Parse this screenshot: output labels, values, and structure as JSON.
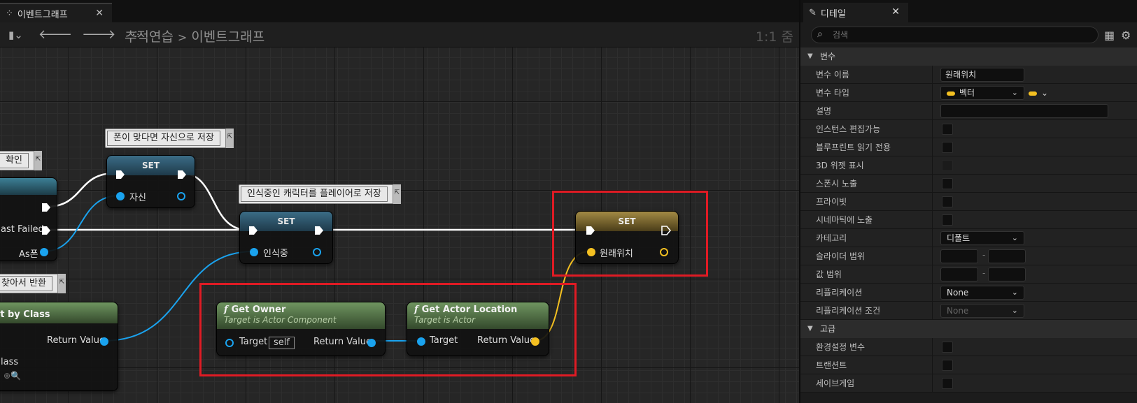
{
  "graph": {
    "tab_title": "이벤트그래프",
    "tab_icon": "graph-tab-icon",
    "breadcrumb": {
      "parent": "추적연습",
      "separator": ">",
      "current": "이벤트그래프"
    },
    "zoom_label": "1:1 줌"
  },
  "nodes": {
    "set1": {
      "title": "SET",
      "var_label": "자신"
    },
    "set2": {
      "title": "SET",
      "var_label": "인식중"
    },
    "set3": {
      "title": "SET",
      "var_label": "원래위치"
    },
    "cast_partial": {
      "failed_label": "ast Failed",
      "as_label": "As폰"
    },
    "getbyclass_partial": {
      "title": "nt by Class",
      "return_label": "Return Value",
      "class_label": "lass"
    },
    "get_owner": {
      "title": "Get Owner",
      "subtitle": "Target is Actor Component",
      "target_label": "Target",
      "self_value": "self",
      "return_label": "Return Value"
    },
    "get_actor_location": {
      "title": "Get Actor Location",
      "subtitle": "Target is Actor",
      "target_label": "Target",
      "return_label": "Return Value"
    }
  },
  "comments": {
    "c1": "폰이 맞다면 자신으로 저장",
    "c2": "인식중인 캐릭터를 플레이어로 저장",
    "c3": "확인",
    "c4": "찾아서 반환"
  },
  "details": {
    "tab_title": "디테일",
    "search_placeholder": "검색",
    "sections": {
      "variable": "변수",
      "advanced": "고급"
    },
    "props": {
      "var_name_label": "변수 이름",
      "var_name_value": "원래위치",
      "var_type_label": "변수 타입",
      "var_type_value": "벡터",
      "description_label": "설명",
      "instance_editable_label": "인스턴스 편집가능",
      "bp_readonly_label": "블루프린트 읽기 전용",
      "show_3d_widget_label": "3D 위젯 표시",
      "expose_on_spawn_label": "스폰시 노출",
      "private_label": "프라이빗",
      "expose_cinematics_label": "시네마틱에 노출",
      "category_label": "카테고리",
      "category_value": "디폴트",
      "slider_range_label": "슬라이더 범위",
      "value_range_label": "값 범위",
      "replication_label": "리플리케이션",
      "replication_value": "None",
      "replication_condition_label": "리플리케이션 조건",
      "replication_condition_value": "None",
      "config_var_label": "환경설정 변수",
      "transient_label": "트랜션트",
      "savegame_label": "세이브게임",
      "range_dash": "-"
    }
  },
  "colors": {
    "exec_wire": "#ffffff",
    "object_pin": "#1aa3ef",
    "vector_pin": "#f4c021",
    "highlight": "#e01b24"
  }
}
